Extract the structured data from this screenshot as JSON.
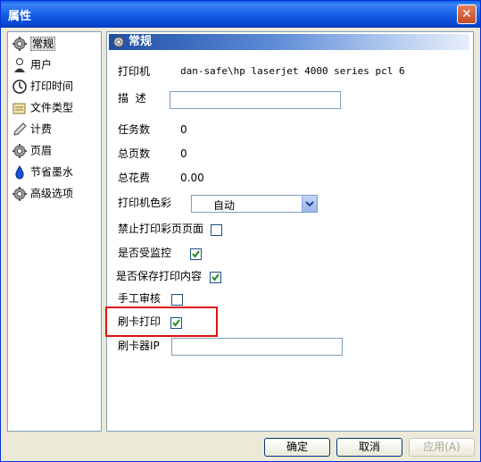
{
  "window": {
    "title": "属性",
    "close": "✕"
  },
  "sidebar": {
    "items": [
      {
        "label": "常规",
        "icon": "gear-icon"
      },
      {
        "label": "用户",
        "icon": "user-icon"
      },
      {
        "label": "打印时间",
        "icon": "clock-icon"
      },
      {
        "label": "文件类型",
        "icon": "file-icon"
      },
      {
        "label": "计费",
        "icon": "pen-icon"
      },
      {
        "label": "页眉",
        "icon": "gear-icon"
      },
      {
        "label": "节省墨水",
        "icon": "ink-drop-icon"
      },
      {
        "label": "高级选项",
        "icon": "gear-icon"
      }
    ],
    "selected": "常规"
  },
  "panel": {
    "title": "常规",
    "printer_label": "打印机",
    "printer_value": "dan-safe\\hp laserjet 4000 series pcl 6",
    "desc_label": "描  述",
    "desc_value": "",
    "tasks_label": "任务数",
    "tasks_value": "0",
    "pages_label": "总页数",
    "pages_value": "0",
    "cost_label": "总花费",
    "cost_value": "0.00",
    "color_label": "打印机色彩",
    "color_value": "自动",
    "ban_color_label": "禁止打印彩页页面",
    "ban_color_checked": false,
    "monitored_label": "是否受监控",
    "monitored_checked": true,
    "save_content_label": "是否保存打印内容",
    "save_content_checked": true,
    "manual_review_label": "手工审核",
    "manual_review_checked": false,
    "card_print_label": "刷卡打印",
    "card_print_checked": true,
    "card_reader_ip_label": "刷卡器IP",
    "card_reader_ip_value": ""
  },
  "buttons": {
    "ok": "确定",
    "cancel": "取消",
    "apply": "应用(A)"
  },
  "colors": {
    "title_bar": "#0a5fe4",
    "highlight": "#e01010",
    "check": "#1e8a1e"
  }
}
